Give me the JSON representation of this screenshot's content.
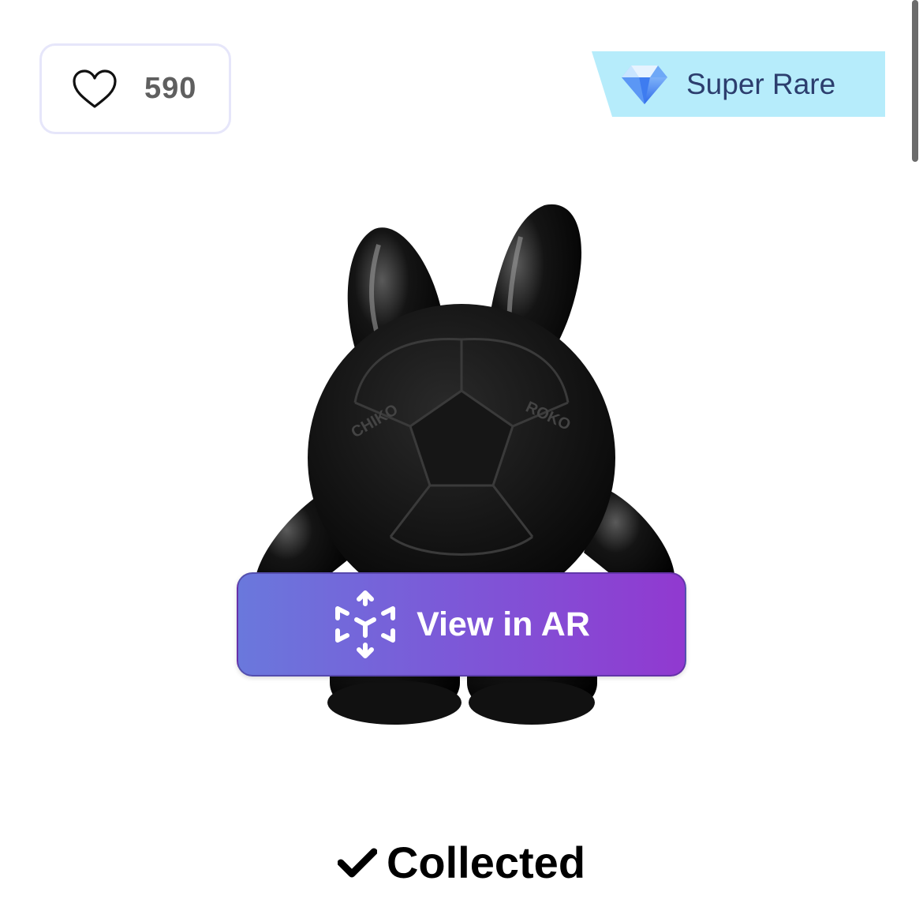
{
  "like": {
    "count": "590",
    "icon": "heart-outline-icon"
  },
  "rarity": {
    "label": "Super Rare",
    "icon": "diamond-icon",
    "color": "#b6ecfb"
  },
  "viewer": {
    "ar_button_label": "View in AR",
    "ar_icon": "ar-cube-icon"
  },
  "status": {
    "label": "Collected",
    "icon": "checkmark-icon"
  },
  "figure": {
    "left_ear_text": "CHIKO",
    "right_ear_text": "ROKO"
  },
  "colors": {
    "ar_gradient_start": "#6a78dc",
    "ar_gradient_end": "#9139d0",
    "like_border": "#e6e6fa"
  }
}
